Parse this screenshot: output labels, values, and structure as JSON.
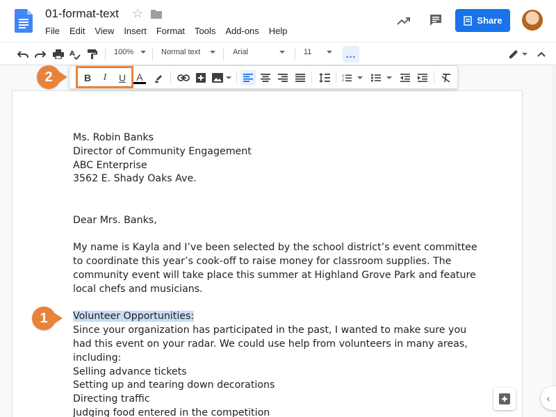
{
  "app": {
    "doc_title": "01-format-text",
    "menu": [
      "File",
      "Edit",
      "View",
      "Insert",
      "Format",
      "Tools",
      "Add-ons",
      "Help"
    ],
    "share_label": "Share"
  },
  "toolbar": {
    "zoom": "100%",
    "style": "Normal text",
    "font": "Arial",
    "font_size": "11"
  },
  "icons": {
    "bold": "B",
    "italic": "I",
    "underline": "U",
    "text_color": "A",
    "more": "..."
  },
  "callouts": {
    "one": "1",
    "two": "2"
  },
  "letter": {
    "address": [
      "Ms. Robin Banks",
      "Director of Community Engagement",
      "ABC Enterprise",
      "3562 E. Shady Oaks Ave."
    ],
    "salutation": "Dear Mrs. Banks,",
    "paragraph1": [
      "My name is Kayla and I’ve been selected by the school district’s event committee",
      "to coordinate this year’s cook-off to raise money for classroom supplies. The",
      "community event will take place this summer at Highland Grove Park and feature",
      "local chefs and musicians."
    ],
    "selected_heading": "Volunteer Opportunities:",
    "paragraph2": [
      "Since your organization has participated in the past, I wanted to make sure you",
      "had this event on your radar. We could use help from volunteers in many areas,",
      "including:"
    ],
    "list": [
      "Selling advance tickets",
      "Setting up and tearing down decorations",
      "Directing traffic",
      "Judging food entered in the competition"
    ]
  },
  "colors": {
    "accent": "#1a73e8",
    "callout": "#e8833a",
    "selection": "#c8dcf8"
  }
}
